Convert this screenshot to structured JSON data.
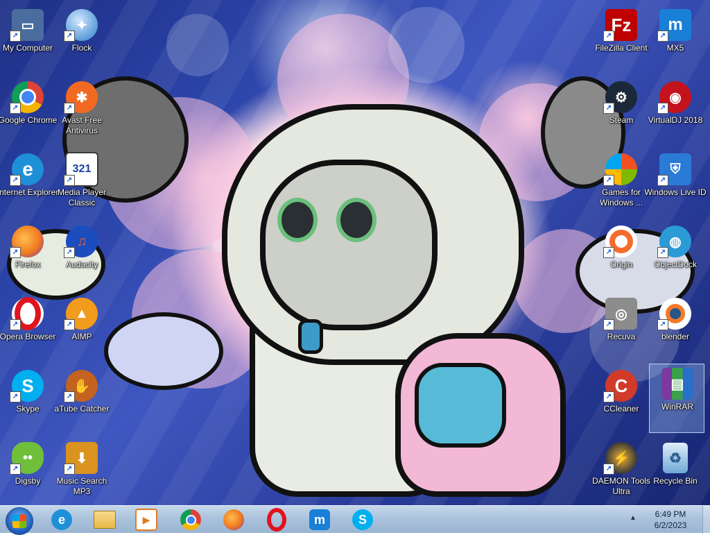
{
  "desktop": {
    "icons": [
      {
        "label": "My Computer",
        "icon": "computer-icon",
        "color": "#4a6d9e"
      },
      {
        "label": "Flock",
        "icon": "flock-icon",
        "color": "#2d7fc9"
      },
      {
        "label": "Google Chrome",
        "icon": "chrome-icon",
        "color": "#db4437"
      },
      {
        "label": "Avast Free Antivirus",
        "icon": "avast-icon",
        "color": "#f26a21"
      },
      {
        "label": "Internet Explorer",
        "icon": "ie-icon",
        "color": "#1e90d8"
      },
      {
        "label": "Media Player Classic",
        "icon": "media-player-icon",
        "color": "#3a3a3a"
      },
      {
        "label": "Firefox",
        "icon": "firefox-icon",
        "color": "#f07a1f"
      },
      {
        "label": "Audacity",
        "icon": "audacity-icon",
        "color": "#1b4dbf"
      },
      {
        "label": "Opera Browser",
        "icon": "opera-icon",
        "color": "#e0141e"
      },
      {
        "label": "AIMP",
        "icon": "aimp-icon",
        "color": "#f29b1d"
      },
      {
        "label": "Skype",
        "icon": "skype-icon",
        "color": "#00aff0"
      },
      {
        "label": "aTube Catcher",
        "icon": "atube-icon",
        "color": "#c4621f"
      },
      {
        "label": "Digsby",
        "icon": "digsby-icon",
        "color": "#6fbf3b"
      },
      {
        "label": "Music Search MP3",
        "icon": "music-search-icon",
        "color": "#d9931e"
      },
      {
        "label": "FileZilla Client",
        "icon": "filezilla-icon",
        "color": "#bf0000"
      },
      {
        "label": "MX5",
        "icon": "mx5-icon",
        "color": "#1a7fd6"
      },
      {
        "label": "Steam",
        "icon": "steam-icon",
        "color": "#1b2838"
      },
      {
        "label": "VirtualDJ 2018",
        "icon": "virtualdj-icon",
        "color": "#c4131d"
      },
      {
        "label": "Games for Windows ...",
        "icon": "games-windows-icon",
        "color": "#3d7f2f"
      },
      {
        "label": "Windows Live ID",
        "icon": "windows-live-icon",
        "color": "#2a7bd6"
      },
      {
        "label": "Origin",
        "icon": "origin-icon",
        "color": "#f56c2d"
      },
      {
        "label": "ObjectDock",
        "icon": "objectdock-icon",
        "color": "#2b9bd8"
      },
      {
        "label": "Recuva",
        "icon": "recuva-icon",
        "color": "#8c8c8c"
      },
      {
        "label": "blender",
        "icon": "blender-icon",
        "color": "#f5792a"
      },
      {
        "label": "CCleaner",
        "icon": "ccleaner-icon",
        "color": "#d23a2a"
      },
      {
        "label": "WinRAR",
        "icon": "winrar-icon",
        "color": "#7a3a9e"
      },
      {
        "label": "DAEMON Tools Ultra",
        "icon": "daemon-tools-icon",
        "color": "#3a3a3a"
      },
      {
        "label": "Recycle Bin",
        "icon": "recycle-bin-icon",
        "color": "#6fa8d6"
      }
    ]
  },
  "taskbar": {
    "start_icon": "windows-start-icon",
    "pinned": [
      {
        "icon": "ie-icon",
        "color": "#1e90d8"
      },
      {
        "icon": "explorer-icon",
        "color": "#e8b84a"
      },
      {
        "icon": "media-player-icon",
        "color": "#e07a1f"
      },
      {
        "icon": "chrome-icon",
        "color": "#db4437"
      },
      {
        "icon": "firefox-icon",
        "color": "#f07a1f"
      },
      {
        "icon": "opera-icon",
        "color": "#e0141e"
      },
      {
        "icon": "mx5-icon",
        "color": "#1a7fd6"
      },
      {
        "icon": "skype-icon",
        "color": "#00aff0"
      }
    ],
    "tray": {
      "time": "6:49 PM",
      "date": "6/2/2023"
    }
  }
}
